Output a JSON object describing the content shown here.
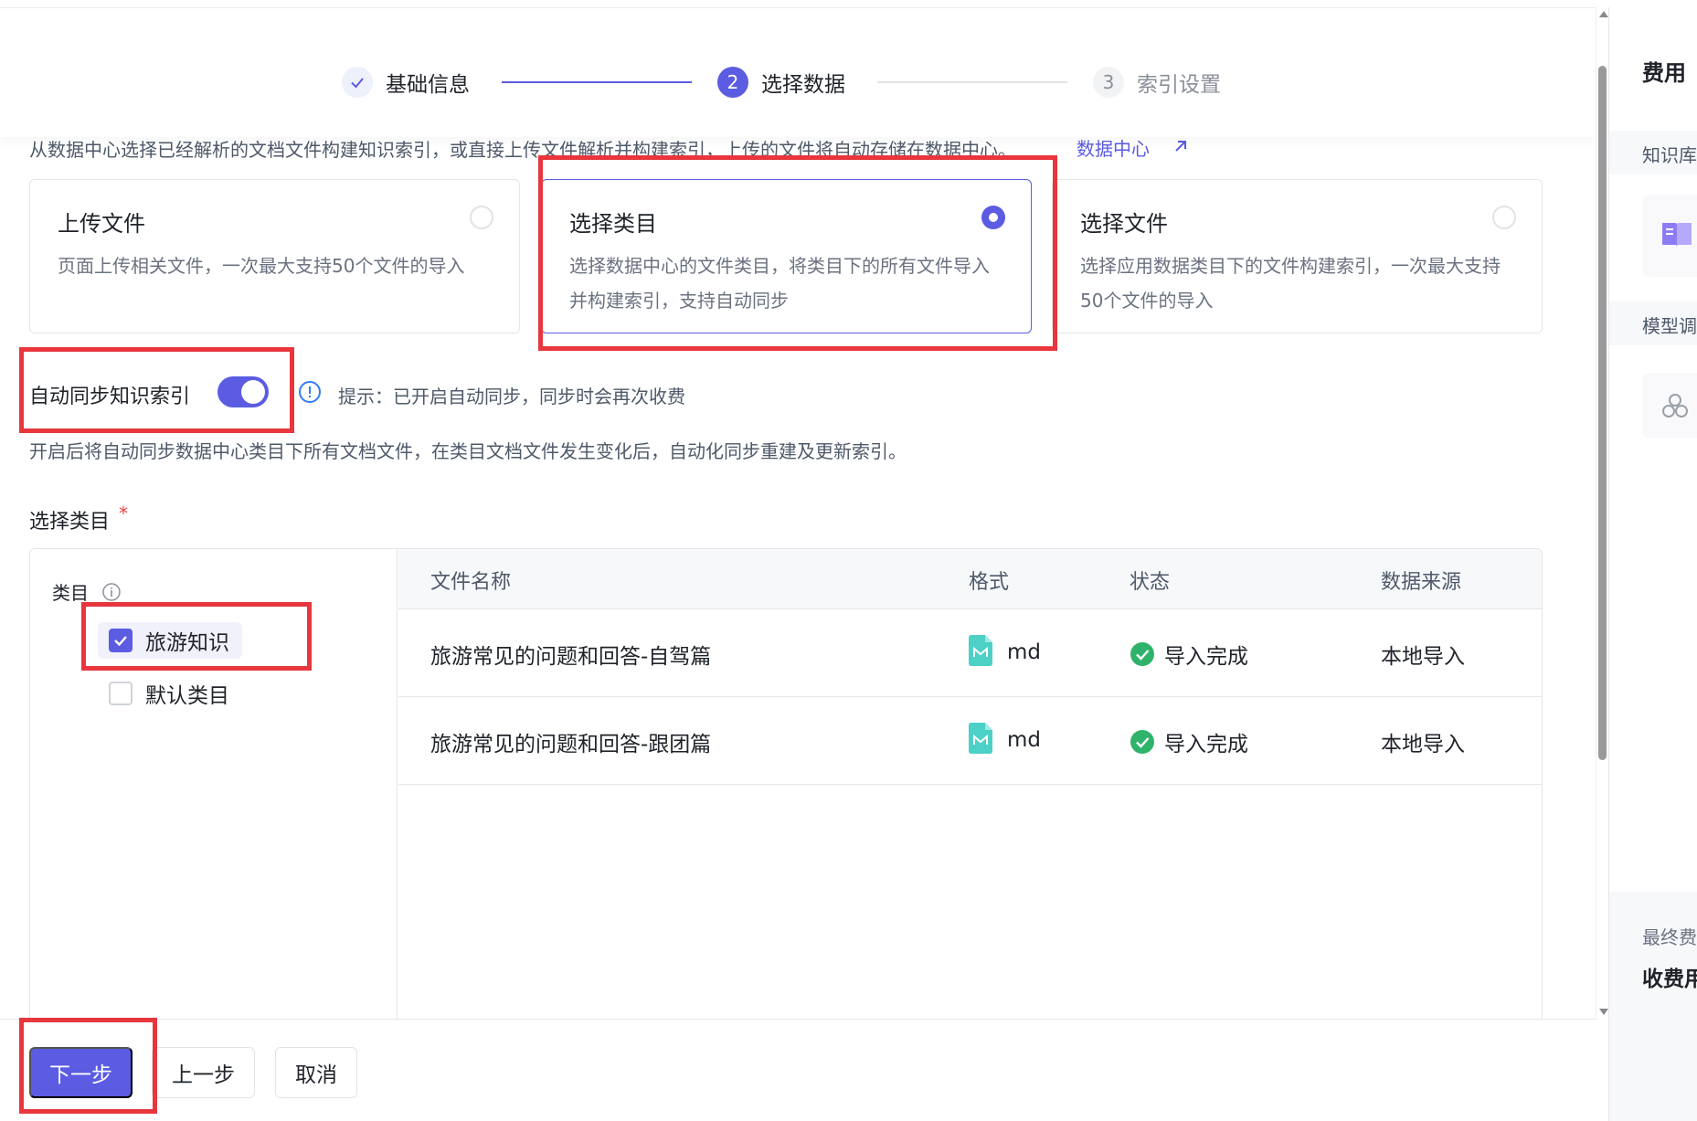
{
  "steps": [
    {
      "number": "✓",
      "label": "基础信息",
      "state": "done"
    },
    {
      "number": "2",
      "label": "选择数据",
      "state": "active"
    },
    {
      "number": "3",
      "label": "索引设置",
      "state": "pending"
    }
  ],
  "intro": {
    "text": "从数据中心选择已经解析的文档文件构建知识索引，或直接上传文件解析并构建索引，上传的文件将自动存储在数据中心。",
    "link_label": "数据中心"
  },
  "options": [
    {
      "title": "上传文件",
      "desc": "页面上传相关文件，一次最大支持50个文件的导入",
      "selected": false
    },
    {
      "title": "选择类目",
      "desc": "选择数据中心的文件类目，将类目下的所有文件导入并构建索引，支持自动同步",
      "selected": true
    },
    {
      "title": "选择文件",
      "desc": "选择应用数据类目下的文件构建索引，一次最大支持50个文件的导入",
      "selected": false
    }
  ],
  "sync": {
    "label": "自动同步知识索引",
    "enabled": true,
    "tip": "提示：已开启自动同步，同步时会再次收费",
    "description": "开启后将自动同步数据中心类目下所有文档文件，在类目文档文件发生变化后，自动化同步重建及更新索引。"
  },
  "category_section": {
    "label": "选择类目",
    "required_mark": "*",
    "column_label": "类目",
    "items": [
      {
        "label": "旅游知识",
        "checked": true
      },
      {
        "label": "默认类目",
        "checked": false
      }
    ]
  },
  "table": {
    "headers": [
      "文件名称",
      "格式",
      "状态",
      "数据来源"
    ],
    "rows": [
      {
        "name": "旅游常见的问题和回答-自驾篇",
        "format": "md",
        "status": "导入完成",
        "source": "本地导入"
      },
      {
        "name": "旅游常见的问题和回答-跟团篇",
        "format": "md",
        "status": "导入完成",
        "source": "本地导入"
      }
    ]
  },
  "footer": {
    "next": "下一步",
    "prev": "上一步",
    "cancel": "取消"
  },
  "side_panel": {
    "title": "费用",
    "section1": "知识库",
    "section2": "模型调",
    "final_label": "最终费",
    "fee_label": "收费用"
  },
  "colors": {
    "accent": "#5b5ce2",
    "success": "#2fb36b",
    "annotation": "#e8363d",
    "required": "#f53f3f"
  }
}
